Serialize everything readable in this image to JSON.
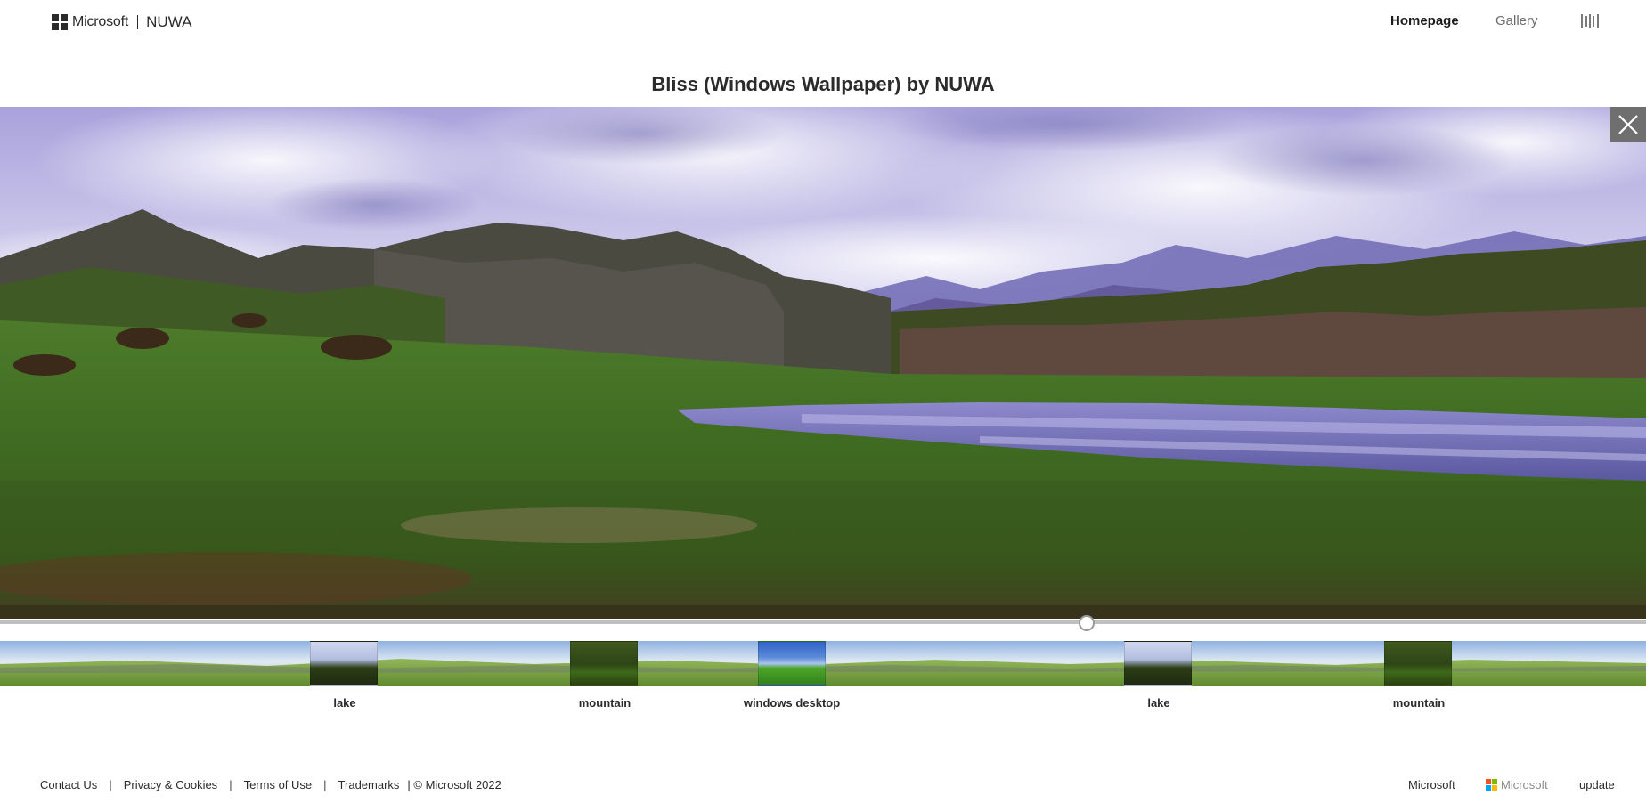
{
  "header": {
    "brand": "Microsoft",
    "product": "NUWA",
    "nav": [
      {
        "label": "Homepage",
        "active": true
      },
      {
        "label": "Gallery",
        "active": false
      }
    ],
    "menu_icon": "barcode-bars-icon"
  },
  "title": "Bliss (Windows Wallpaper) by NUWA",
  "viewer": {
    "close_icon": "close-icon",
    "slider_position": 0.66
  },
  "thumbnails": [
    {
      "label": "lake"
    },
    {
      "label": "mountain"
    },
    {
      "label": "windows desktop"
    },
    {
      "label": "lake"
    },
    {
      "label": "mountain"
    }
  ],
  "footer": {
    "links": [
      "Contact Us",
      "Privacy & Cookies",
      "Terms of Use",
      "Trademarks"
    ],
    "copyright": "| © Microsoft 2022",
    "right_text": "Microsoft",
    "logo_text": "Microsoft",
    "update": "update"
  },
  "colors": {
    "ms_red": "#f25022",
    "ms_green": "#7fba00",
    "ms_blue": "#00a4ef",
    "ms_yellow": "#ffb900"
  }
}
